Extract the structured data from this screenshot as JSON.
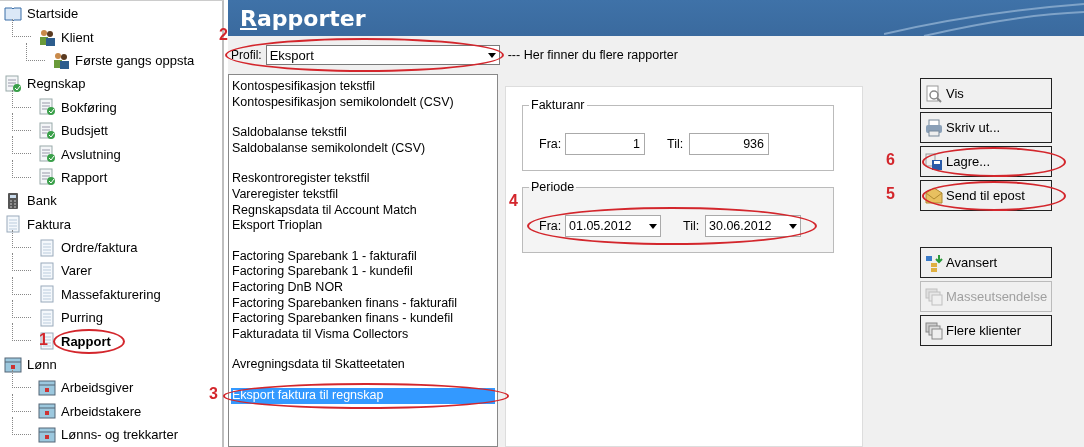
{
  "tree": [
    {
      "label": "Startside",
      "kind": "book",
      "selected": false,
      "children": [
        {
          "label": "Klient",
          "kind": "people",
          "selected": false,
          "children": [
            {
              "label": "Første gangs oppsta",
              "kind": "people",
              "selected": false
            }
          ]
        }
      ]
    },
    {
      "label": "Regnskap",
      "kind": "ledger",
      "selected": false,
      "children": [
        {
          "label": "Bokføring",
          "kind": "ledger",
          "selected": false
        },
        {
          "label": "Budsjett",
          "kind": "ledger",
          "selected": false
        },
        {
          "label": "Avslutning",
          "kind": "ledger",
          "selected": false
        },
        {
          "label": "Rapport",
          "kind": "ledger",
          "selected": false
        }
      ]
    },
    {
      "label": "Bank",
      "kind": "calculator",
      "selected": false
    },
    {
      "label": "Faktura",
      "kind": "page",
      "selected": false,
      "children": [
        {
          "label": "Ordre/faktura",
          "kind": "page",
          "selected": false
        },
        {
          "label": "Varer",
          "kind": "page",
          "selected": false
        },
        {
          "label": "Massefakturering",
          "kind": "page",
          "selected": false
        },
        {
          "label": "Purring",
          "kind": "page",
          "selected": false
        },
        {
          "label": "Rapport",
          "kind": "page",
          "selected": true,
          "marker": "1"
        }
      ]
    },
    {
      "label": "Lønn",
      "kind": "calendar",
      "selected": false,
      "children": [
        {
          "label": "Arbeidsgiver",
          "kind": "calendar",
          "selected": false
        },
        {
          "label": "Arbeidstakere",
          "kind": "calendar",
          "selected": false
        },
        {
          "label": "Lønns- og trekkarter",
          "kind": "calendar",
          "selected": false
        }
      ]
    }
  ],
  "header": {
    "title": "Rapporter"
  },
  "profile": {
    "label": "Profil:",
    "value": "Eksport",
    "marker": "2",
    "hint": "--- Her finner du flere rapporter"
  },
  "report_groups": [
    [
      {
        "label": "Kontospesifikasjon tekstfil",
        "selected": false
      },
      {
        "label": "Kontospesifikasjon semikolondelt (CSV)",
        "selected": false
      }
    ],
    [
      {
        "label": "Saldobalanse tekstfil",
        "selected": false
      },
      {
        "label": "Saldobalanse semikolondelt (CSV)",
        "selected": false
      }
    ],
    [
      {
        "label": "Reskontroregister tekstfil",
        "selected": false
      },
      {
        "label": "Vareregister tekstfil",
        "selected": false
      },
      {
        "label": "Regnskapsdata til Account Match",
        "selected": false
      },
      {
        "label": "Eksport Trioplan",
        "selected": false
      }
    ],
    [
      {
        "label": "Factoring Sparebank 1 - fakturafil",
        "selected": false
      },
      {
        "label": "Factoring Sparebank 1 - kundefil",
        "selected": false
      },
      {
        "label": "Factoring DnB NOR",
        "selected": false
      },
      {
        "label": "Factoring Sparebanken finans - fakturafil",
        "selected": false
      },
      {
        "label": "Factoring Sparebanken finans - kundefil",
        "selected": false
      },
      {
        "label": "Fakturadata til Visma Collectors",
        "selected": false
      }
    ],
    [
      {
        "label": "Avregningsdata til Skatteetaten",
        "selected": false
      }
    ],
    [
      {
        "label": "Eksport faktura til regnskap",
        "selected": true,
        "marker": "3"
      }
    ]
  ],
  "invoice_no": {
    "title": "Fakturanr",
    "from_label": "Fra:",
    "from": "1",
    "to_label": "Til:",
    "to": "936"
  },
  "period": {
    "title": "Periode",
    "marker": "4",
    "from_label": "Fra:",
    "from": "01.05.2012",
    "to_label": "Til:",
    "to": "30.06.2012"
  },
  "buttons": [
    [
      {
        "label": "Vis",
        "kind": "preview",
        "disabled": false
      },
      {
        "label": "Skriv ut...",
        "kind": "printer",
        "disabled": false
      },
      {
        "label": "Lagre...",
        "kind": "save",
        "disabled": false,
        "marker": "6"
      },
      {
        "label": "Send til epost",
        "kind": "mail",
        "disabled": false,
        "marker": "5"
      }
    ],
    [
      {
        "label": "Avansert",
        "kind": "advanced",
        "disabled": false
      },
      {
        "label": "Masseutsendelse",
        "kind": "stack",
        "disabled": true
      },
      {
        "label": "Flere klienter",
        "kind": "stack",
        "disabled": false
      }
    ]
  ]
}
